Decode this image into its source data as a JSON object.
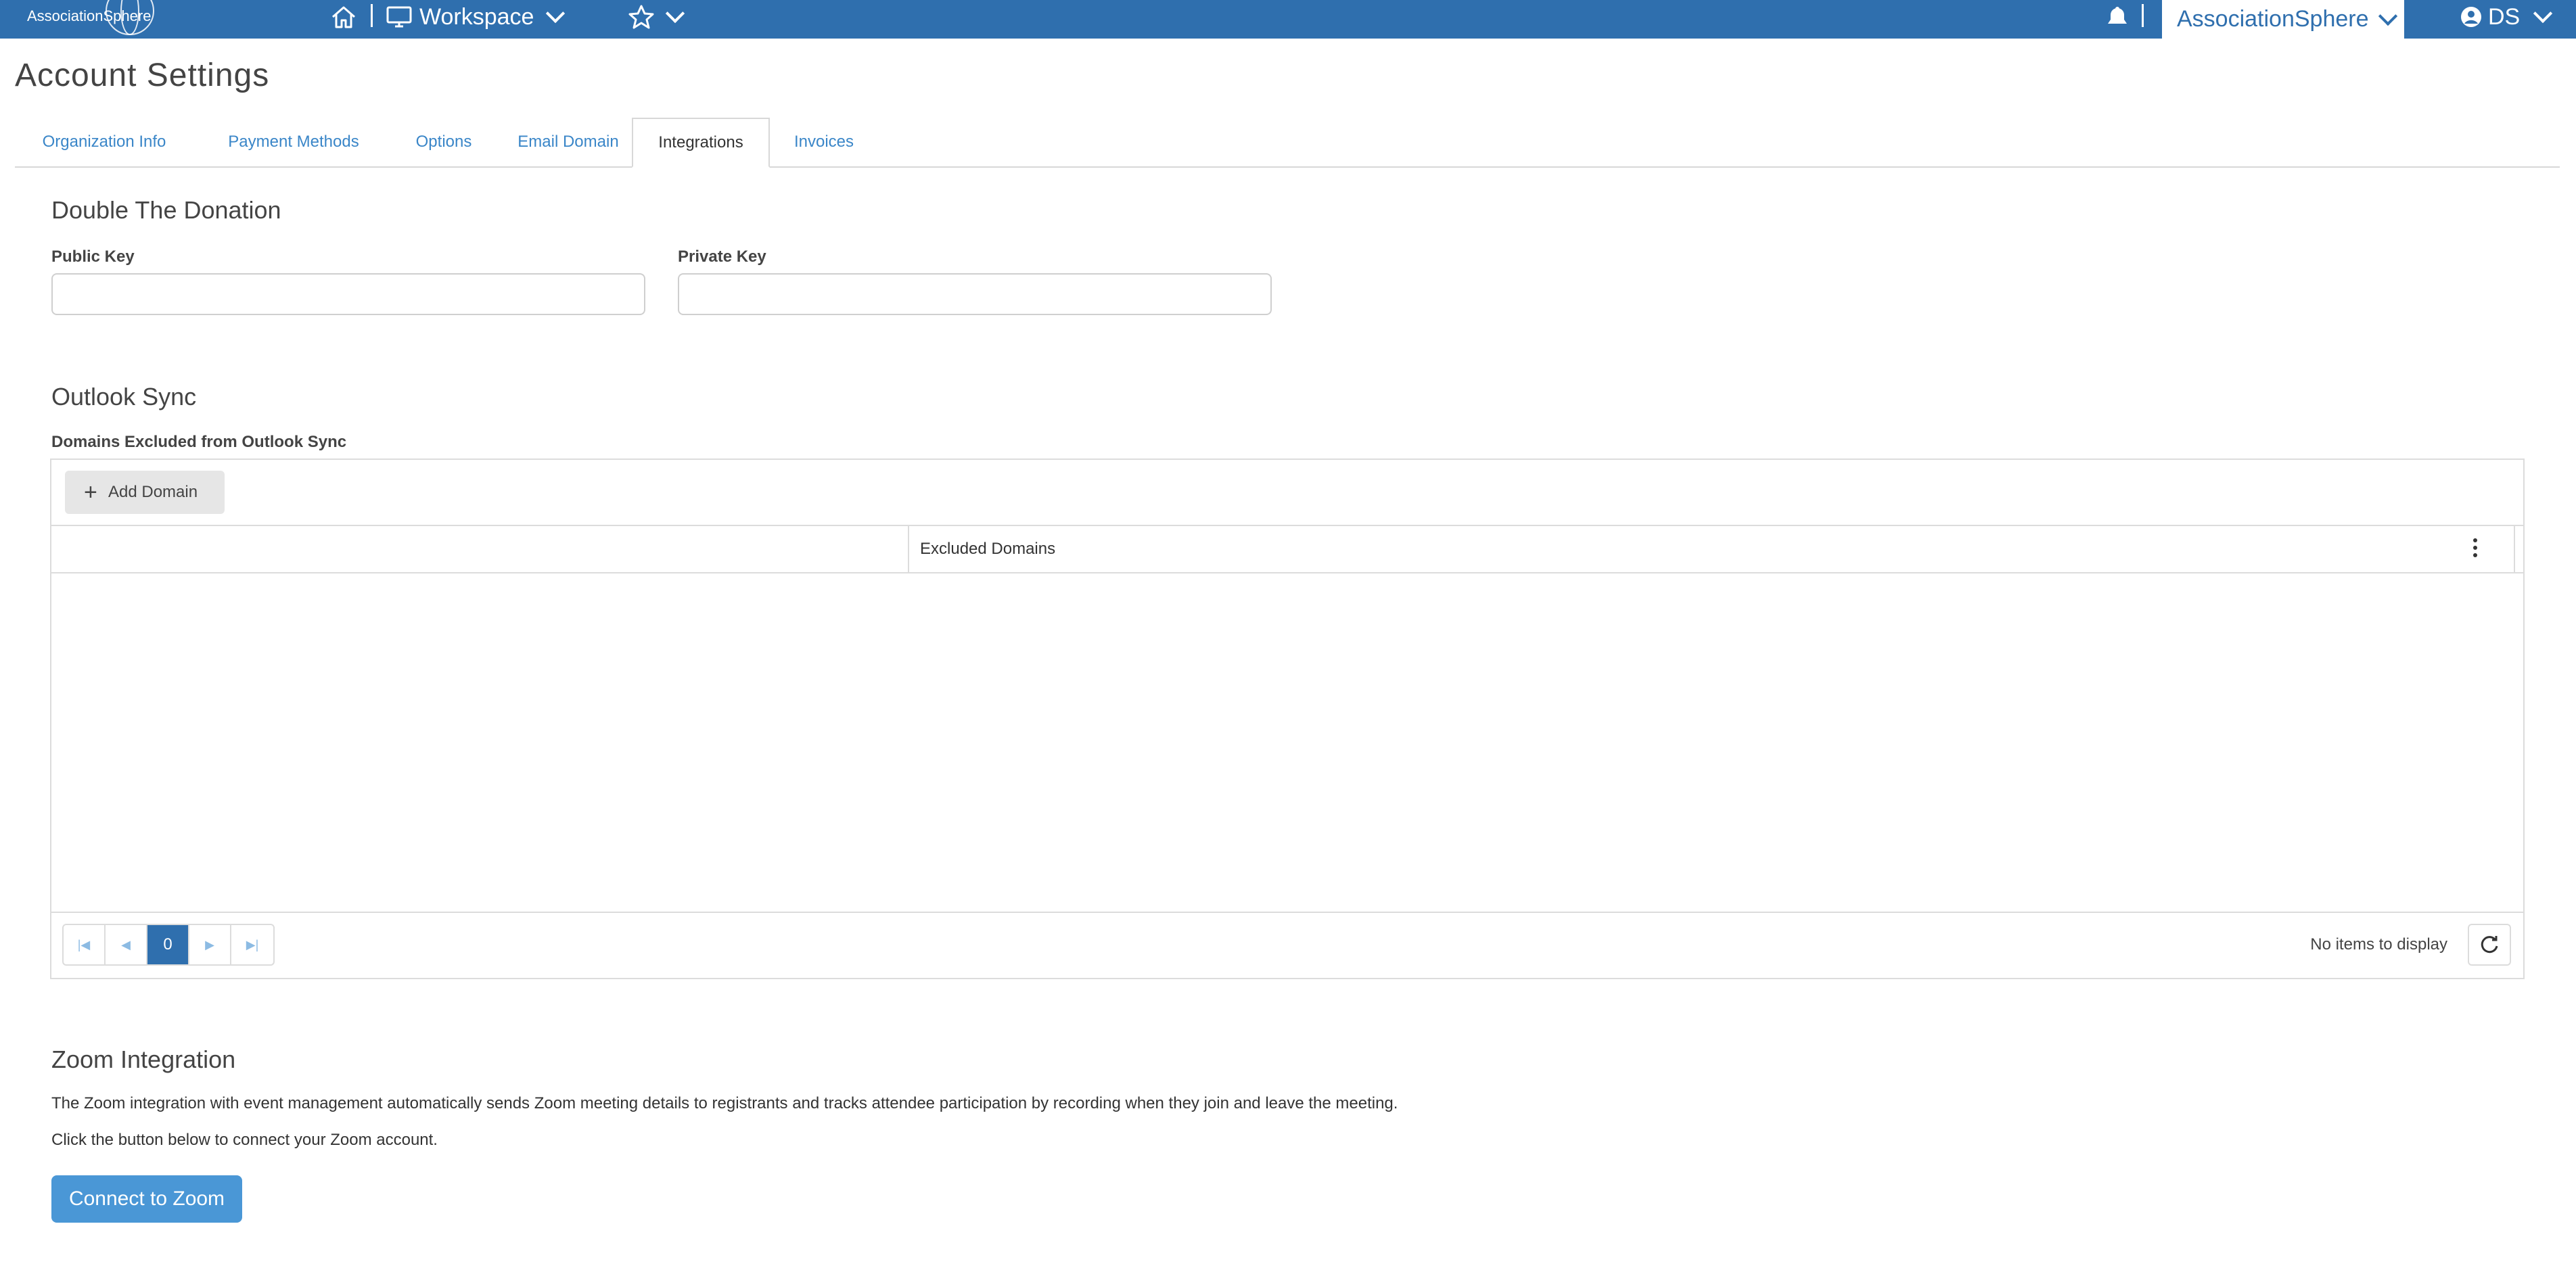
{
  "topbar": {
    "logo_text": "AssociationSphere",
    "workspace_label": "Workspace",
    "org_label": "AssociationSphere",
    "user_initials": "DS"
  },
  "page": {
    "title": "Account Settings"
  },
  "tabs": [
    {
      "label": "Organization Info"
    },
    {
      "label": "Payment Methods"
    },
    {
      "label": "Options"
    },
    {
      "label": "Email Domain"
    },
    {
      "label": "Integrations",
      "active": true
    },
    {
      "label": "Invoices"
    }
  ],
  "double_donation": {
    "heading": "Double The Donation",
    "public_key_label": "Public Key",
    "public_key_value": "",
    "private_key_label": "Private Key",
    "private_key_value": ""
  },
  "outlook": {
    "heading": "Outlook Sync",
    "grid_label": "Domains Excluded from Outlook Sync",
    "add_button": "Add Domain",
    "column_header": "Excluded Domains",
    "current_page": "0",
    "status_text": "No items to display"
  },
  "zoom": {
    "heading": "Zoom Integration",
    "description": "The Zoom integration with event management automatically sends Zoom meeting details to registrants and tracks attendee participation by recording when they join and leave the meeting.",
    "instruction": "Click the button below to connect your Zoom account.",
    "button": "Connect to Zoom"
  },
  "colors": {
    "primary": "#2f6fae",
    "button": "#4a97d6",
    "link": "#3a86c8"
  }
}
